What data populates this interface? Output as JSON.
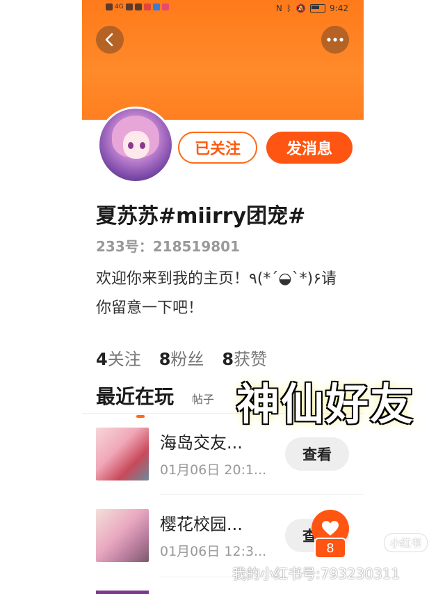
{
  "status_bar": {
    "time": "9:42",
    "signal": "4G"
  },
  "profile": {
    "name": "夏苏苏#miirry团宠#",
    "uid": "233号：218519801",
    "bio": "欢迎你来到我的主页！٩(*´◒`*)۶请你留意一下吧！",
    "follow_label": "已关注",
    "message_label": "发消息"
  },
  "stats": {
    "following_count": "4",
    "following_label": "关注",
    "fans_count": "8",
    "fans_label": "粉丝",
    "likes_count": "8",
    "likes_label": "获赞"
  },
  "tabs": {
    "active": "最近在玩",
    "second": "帖子"
  },
  "games": [
    {
      "title": "海岛交友...",
      "time": "01月06日 20:1...",
      "button": "查看"
    },
    {
      "title": "樱花校园...",
      "time": "01月06日 12:3...",
      "button": "查看"
    }
  ],
  "floating_like": {
    "count": "8"
  },
  "overlay": {
    "caption": "神仙好友",
    "watermark_logo": "小红书",
    "watermark_text": "我的小红书号:793230311"
  },
  "colors": {
    "accent": "#ff5512",
    "header": "#ff7a1a"
  }
}
